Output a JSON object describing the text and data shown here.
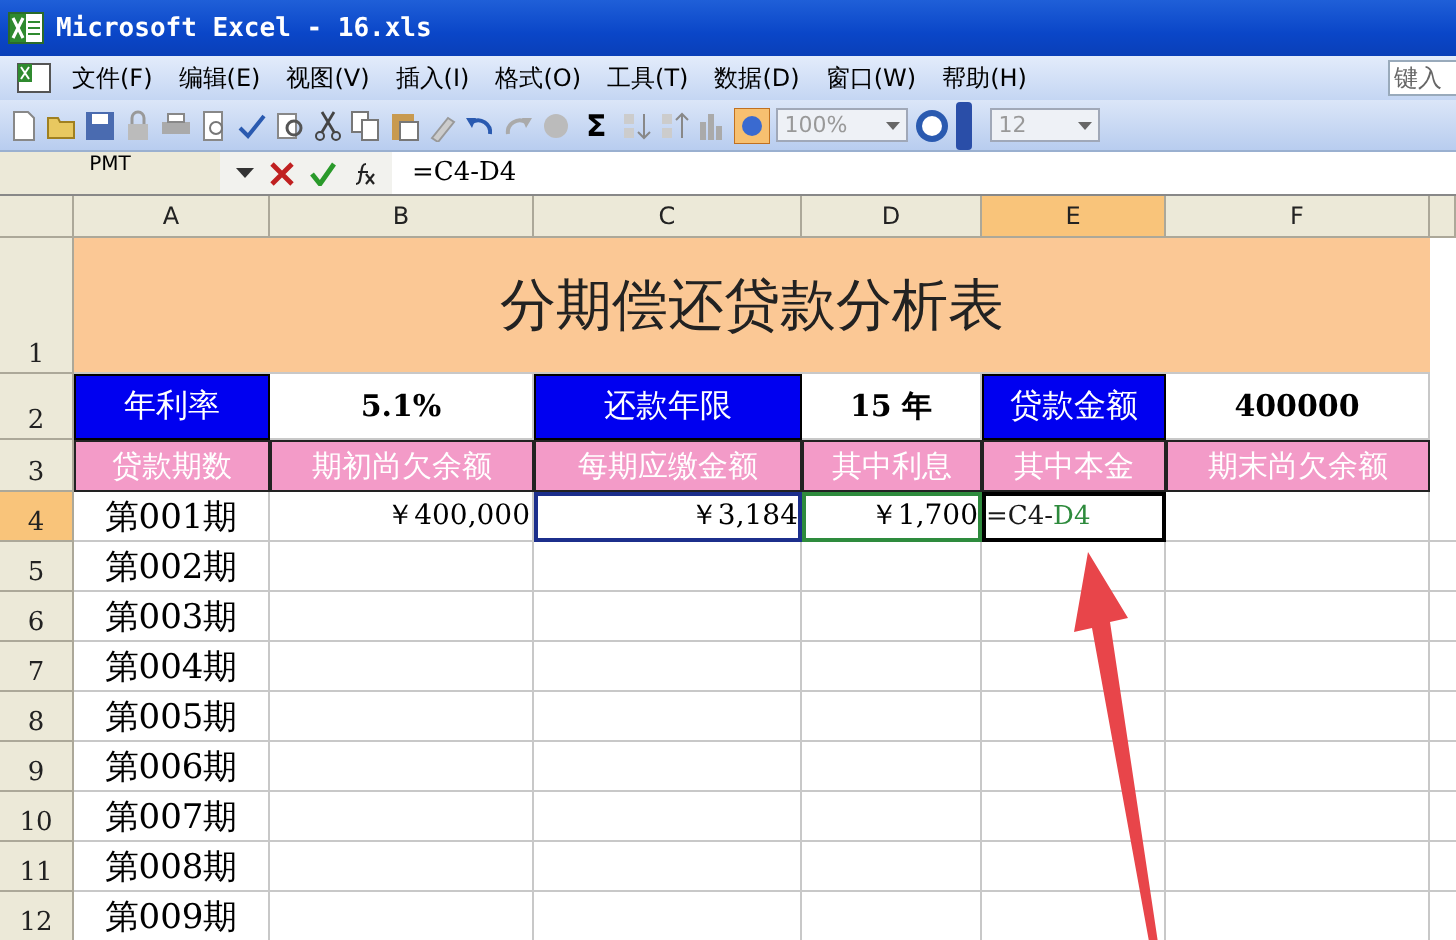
{
  "title_bar": {
    "title": "Microsoft Excel - 16.xls"
  },
  "menu": {
    "items": [
      {
        "label": "文件(F)"
      },
      {
        "label": "编辑(E)"
      },
      {
        "label": "视图(V)"
      },
      {
        "label": "插入(I)"
      },
      {
        "label": "格式(O)"
      },
      {
        "label": "工具(T)"
      },
      {
        "label": "数据(D)"
      },
      {
        "label": "窗口(W)"
      },
      {
        "label": "帮助(H)"
      }
    ],
    "help_search": {
      "placeholder": "键入"
    }
  },
  "toolbar": {
    "autosum": "Σ",
    "zoom": "100%",
    "font_size": "12"
  },
  "formula_bar": {
    "name_box": "PMT",
    "formula": "=C4-D4"
  },
  "sheet": {
    "columns": [
      {
        "label": "A",
        "selected": false
      },
      {
        "label": "B",
        "selected": false
      },
      {
        "label": "C",
        "selected": false
      },
      {
        "label": "D",
        "selected": false
      },
      {
        "label": "E",
        "selected": true
      },
      {
        "label": "F",
        "selected": false
      }
    ],
    "rows": [
      {
        "number": "1",
        "selected": false,
        "kind": "title",
        "cells": [
          {
            "text": "分期偿还贷款分析表",
            "colspan": 6
          }
        ]
      },
      {
        "number": "2",
        "selected": false,
        "kind": "params",
        "cells": [
          {
            "text": "年利率",
            "kind": "label"
          },
          {
            "text": "5.1%",
            "kind": "value"
          },
          {
            "text": "还款年限",
            "kind": "label"
          },
          {
            "text": "15 年",
            "kind": "value"
          },
          {
            "text": "贷款金额",
            "kind": "label"
          },
          {
            "text": "400000",
            "kind": "value"
          }
        ]
      },
      {
        "number": "3",
        "selected": false,
        "kind": "header",
        "cells": [
          {
            "text": "贷款期数"
          },
          {
            "text": "期初尚欠余额"
          },
          {
            "text": "每期应缴金额"
          },
          {
            "text": "其中利息"
          },
          {
            "text": "其中本金"
          },
          {
            "text": "期末尚欠余额"
          }
        ]
      },
      {
        "number": "4",
        "selected": true,
        "kind": "data",
        "cells": [
          {
            "text": "第001期",
            "kind": "value"
          },
          {
            "text": "￥400,000",
            "kind": "value"
          },
          {
            "text": "￥3,184",
            "kind": "value",
            "color": "#1c2f8c"
          },
          {
            "text": "￥1,700",
            "kind": "value",
            "color": "#2e8b3d"
          },
          {
            "kind": "editing",
            "parts": [
              {
                "text": "=C4-",
                "color": "#1a1a1a"
              },
              {
                "text": "D4",
                "color": "#2e8b3d"
              }
            ]
          }
        ]
      },
      {
        "number": "5",
        "selected": false,
        "kind": "data",
        "cells": [
          {
            "text": "第002期",
            "kind": "value"
          }
        ]
      },
      {
        "number": "6",
        "selected": false,
        "kind": "data",
        "cells": [
          {
            "text": "第003期",
            "kind": "value"
          }
        ]
      },
      {
        "number": "7",
        "selected": false,
        "kind": "data",
        "cells": [
          {
            "text": "第004期",
            "kind": "value"
          }
        ]
      },
      {
        "number": "8",
        "selected": false,
        "kind": "data",
        "cells": [
          {
            "text": "第005期",
            "kind": "value"
          }
        ]
      },
      {
        "number": "9",
        "selected": false,
        "kind": "data",
        "cells": [
          {
            "text": "第006期",
            "kind": "value"
          }
        ]
      },
      {
        "number": "10",
        "selected": false,
        "kind": "data",
        "cells": [
          {
            "text": "第007期",
            "kind": "value"
          }
        ]
      },
      {
        "number": "11",
        "selected": false,
        "kind": "data",
        "cells": [
          {
            "text": "第008期",
            "kind": "value"
          }
        ]
      },
      {
        "number": "12",
        "selected": false,
        "kind": "data",
        "cells": [
          {
            "text": "第009期",
            "kind": "value"
          }
        ]
      }
    ]
  }
}
